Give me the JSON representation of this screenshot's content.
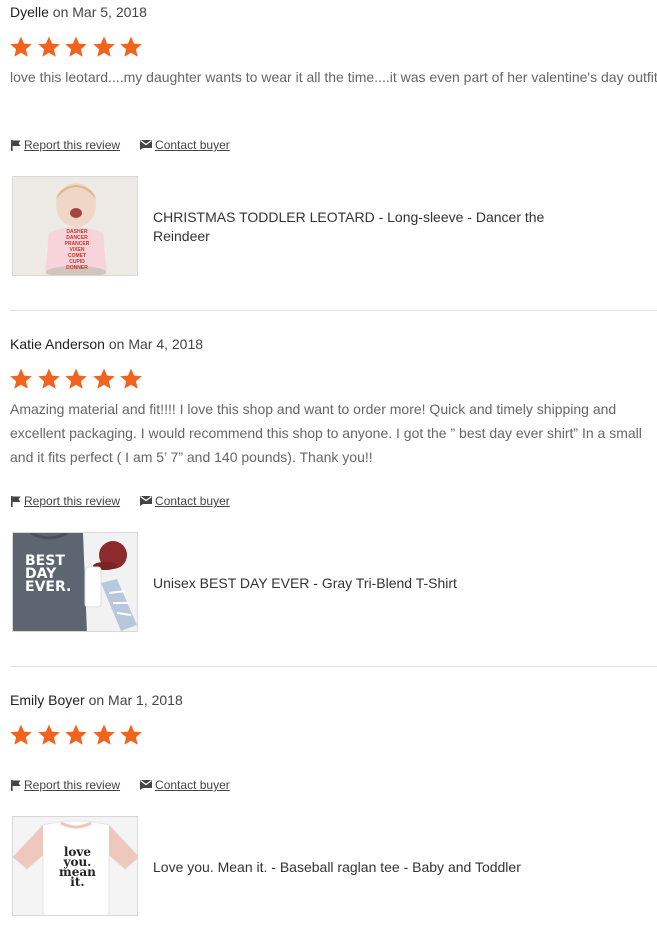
{
  "reviews": [
    {
      "name": "Dyelle",
      "date_text": " on Mar 5, 2018",
      "rating": 5,
      "text": "love this leotard....my daughter wants to wear it all the time....it was even part of her valentine's day outfit",
      "report_label": " Report this review",
      "contact_label": "Contact buyer",
      "product_title": "CHRISTMAS TODDLER LEOTARD - Long-sleeve - Dancer the Reindeer",
      "thumb_text": [
        "DASHER",
        "DANCER",
        "PRANCER",
        "VIXEN",
        "COMET",
        "CUPID",
        "DONNER"
      ]
    },
    {
      "name": "Katie Anderson",
      "date_text": " on Mar 4, 2018",
      "rating": 5,
      "text": "Amazing material and fit!!!! I love this shop and want to order more! Quick and timely shipping and excellent packaging. I would recommend this shop to anyone. I got the ” best day ever shirt” In a small and it fits perfect ( I am 5’ 7” and 140 pounds). Thank you!!",
      "report_label": " Report this review",
      "contact_label": "Contact buyer",
      "product_title": "Unisex BEST DAY EVER - Gray Tri-Blend T-Shirt",
      "thumb_text": [
        "BEST",
        "DAY",
        "EVER."
      ]
    },
    {
      "name": "Emily Boyer",
      "date_text": " on Mar 1, 2018",
      "rating": 5,
      "text": "",
      "report_label": " Report this review",
      "contact_label": "Contact buyer",
      "product_title": "Love you. Mean it. - Baseball raglan tee - Baby and Toddler",
      "thumb_text": [
        "love",
        "you.",
        "mean",
        "it."
      ]
    }
  ],
  "colors": {
    "star": "#f1641e",
    "divider": "#e0e0e0"
  },
  "icons": {
    "report": "flag-icon",
    "contact": "envelope-icon",
    "star": "star-icon"
  }
}
